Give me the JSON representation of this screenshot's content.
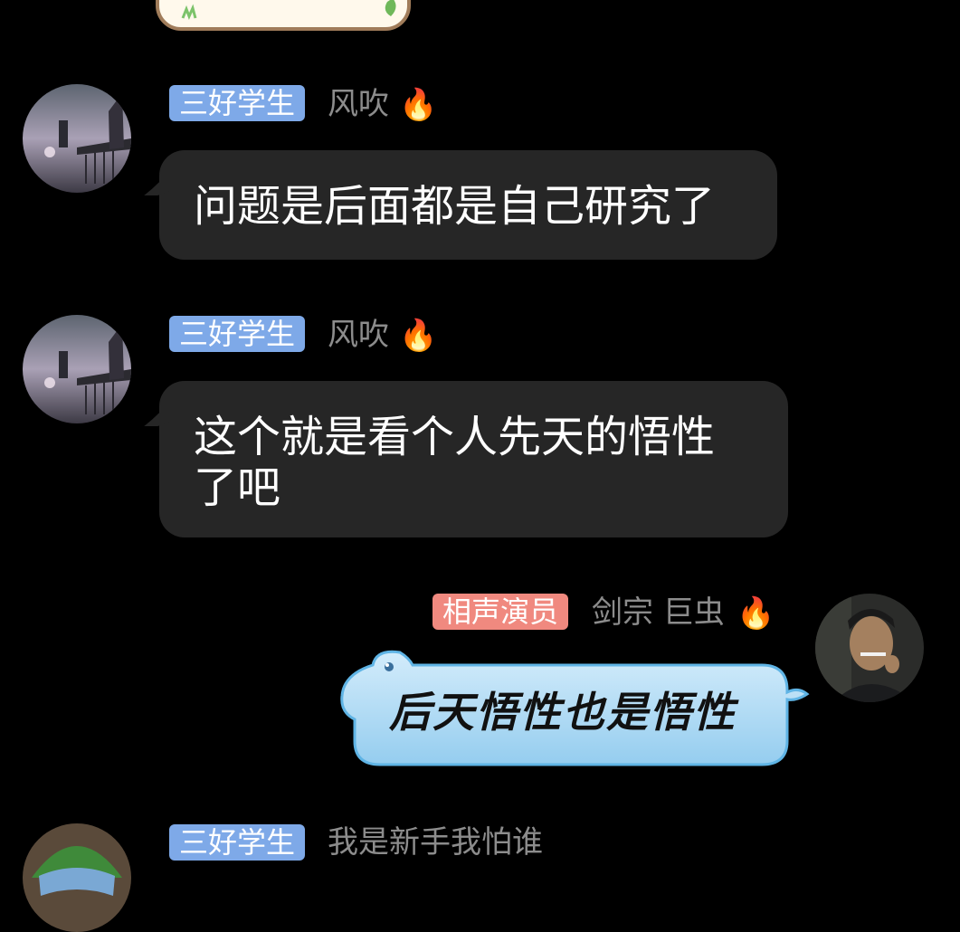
{
  "messages": [
    {
      "role_tag": "三好学生",
      "name": "风吹",
      "text": "问题是后面都是自己研究了"
    },
    {
      "role_tag": "三好学生",
      "name": "风吹",
      "text_line1": "这个就是看个人先天的悟性",
      "text_line2": "了吧"
    },
    {
      "role_tag": "相声演员",
      "name": "剑宗 巨虫",
      "text": "后天悟性也是悟性"
    },
    {
      "role_tag": "三好学生",
      "name": "我是新手我怕谁"
    }
  ],
  "icons": {
    "flame": "fire-icon"
  },
  "colors": {
    "background": "#000000",
    "bubble": "#262626",
    "tag_blue": "#7ea9e8",
    "tag_pink": "#f0897f",
    "fancy_bubble": "#a9d4f2"
  }
}
